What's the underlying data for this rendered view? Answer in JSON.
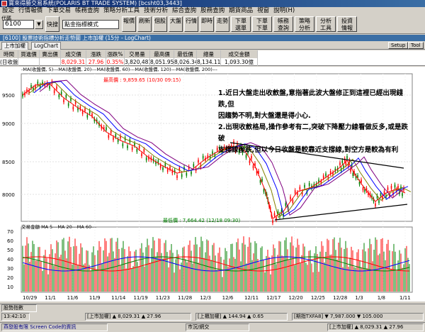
{
  "window": {
    "title": "寶來得勝交易系統(POLARIS BT TRADE SYSTEM) [bcsht03,3443]"
  },
  "menu": [
    "設定",
    "行情報價",
    "下單交易",
    "帳務查詢",
    "策略分析工具",
    "技術分析",
    "綜合查詢",
    "股務查詢",
    "期貨商品",
    "視窗",
    "說明(H)"
  ],
  "toolbar": {
    "code_label": "代碼",
    "code_value": "6100",
    "search_btn": "快搜",
    "mode_label": "點金指標模式",
    "buttons": [
      "報價",
      "刷新",
      "個股",
      "大盤",
      "行情",
      "即時",
      "走勢",
      "下單\n選單",
      "下單\n下單",
      "帳務\n查詢",
      "策略\n分析",
      "分析\n工具",
      "投資\n情報"
    ]
  },
  "subwindow": {
    "title": "[6100] 股票技術指標分析走勢圖 上市加權 (15分 - LogChart)"
  },
  "tabs": [
    "上市加權",
    "LogChart"
  ],
  "right_buttons": [
    "Setup",
    "Tool"
  ],
  "quote": {
    "headers": [
      "時間",
      "買進價",
      "賣出價",
      "成交價",
      "漲跌",
      "漲跌%",
      "交易量",
      "最高價",
      "最低價",
      "總量",
      "成交金額"
    ],
    "values": [
      "(日收盤)",
      "",
      "",
      "8,029.31",
      "27.96",
      "0.35%",
      "3,820,481",
      "8,051.95",
      "8,026.34",
      "8,134.11",
      "1,093.30億"
    ]
  },
  "chart_legend": "-MA(收盤價, 5)---MA(收盤價, 20)---MA(收盤價, 60)---MA(收盤價, 120)---MA(收盤價, 200)---",
  "high_label": "最高價 : 9,859.65 (10/30 09:15)",
  "low_label": "最低價 : 7,664.42 (12/18 09:30)",
  "volume_legend": "交易金額 MA 5---MA 20---MA 60---",
  "annotation": {
    "line1": "1.近日大盤走出收斂盤,意指著此波大盤修正到這裡已經出現錢跌,但",
    "line2": "因趨勢不明,對大盤還是得小心.",
    "line3": "2.出現收斂格局,操作參考有二,突破下降壓力線看做反多,或是跌破",
    "line4": "支撐線後跌,但以今日收盤是較靠近支撐線,對空方是較為有利"
  },
  "chart_data": {
    "type": "line",
    "x": [
      "10/29",
      "11/1",
      "11/6",
      "11/9",
      "11/14",
      "11/19",
      "11/23",
      "11/28",
      "12/3",
      "12/6",
      "12/11",
      "12/17",
      "12/20",
      "12/25",
      "12/28",
      "1/3",
      "1/8",
      "1/11"
    ],
    "price_axis": [
      "9500",
      "9000",
      "8500",
      "8000"
    ],
    "volume_axis": [
      "70",
      "60",
      "50",
      "40",
      "30",
      "20",
      "10"
    ],
    "series": []
  },
  "status": {
    "row1_label": "股勢指數",
    "row2_time": "13:42:10",
    "row2_a": "[上市加權] ▲ 8,029.31  ▲ 27.96",
    "row2_b": "[上櫃加權] ▲ 144.94  ▲ 0.65",
    "row2_c": "[期指TXFA8] ▼ 7,987.000  ▼ 105.000",
    "row3_marquee": "燕發股有限 Screen Code的資訊",
    "row3_mid": "市況/網交",
    "row3_right": "[上市加權] ▲ 8,029.31  ▲ 27.96"
  },
  "colors": {
    "up": "#ff0000",
    "down": "#008000",
    "ma5": "#ff0000",
    "ma20": "#808000",
    "ma60": "#0000ff",
    "ma120": "#800080"
  }
}
